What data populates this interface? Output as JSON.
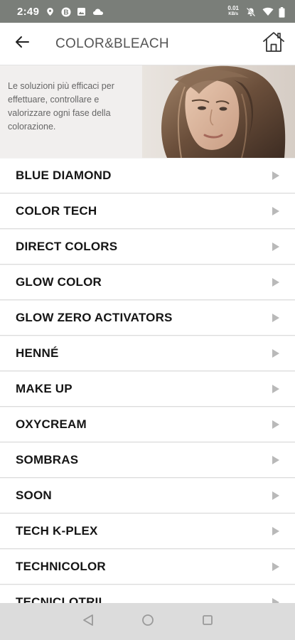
{
  "status_bar": {
    "time": "2:49",
    "net_speed_value": "0.01",
    "net_speed_unit": "KB/s",
    "icons": [
      "location-icon",
      "b-badge-icon",
      "image-icon",
      "cloud-icon",
      "mute-icon",
      "wifi-icon",
      "battery-icon"
    ]
  },
  "header": {
    "title": "COLOR&BLEACH",
    "back_icon": "arrow-left-icon",
    "home_icon": "home-icon"
  },
  "banner": {
    "description": "Le soluzioni più efficaci per effettuare, controllare e valorizzare ogni fase della colorazione."
  },
  "categories": [
    {
      "label": "BLUE DIAMOND"
    },
    {
      "label": "COLOR TECH"
    },
    {
      "label": "DIRECT COLORS"
    },
    {
      "label": "GLOW COLOR"
    },
    {
      "label": "GLOW ZERO ACTIVATORS"
    },
    {
      "label": "HENNÉ"
    },
    {
      "label": "MAKE UP"
    },
    {
      "label": "OXYCREAM"
    },
    {
      "label": "SOMBRAS"
    },
    {
      "label": "SOON"
    },
    {
      "label": "TECH K-PLEX"
    },
    {
      "label": "TECHNICOLOR"
    },
    {
      "label": "TECNICLOTRIL"
    }
  ],
  "nav_bar": {
    "icons": [
      "nav-back-icon",
      "nav-home-icon",
      "nav-recents-icon"
    ]
  },
  "colors": {
    "status_bar": "#7a7e79",
    "banner_bg": "#f1efee",
    "chevron": "#b9b9b9",
    "nav_bar": "#dcdcdc"
  }
}
